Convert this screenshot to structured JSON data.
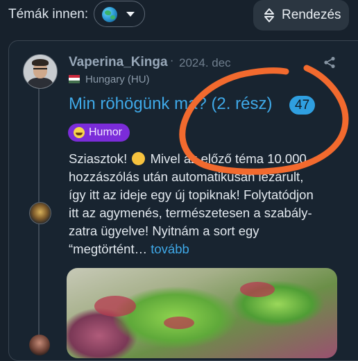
{
  "topbar": {
    "topics_label": "Témák innen:",
    "sort_label": "Rendezés",
    "globe_icon": "globe-icon",
    "sort_icon": "sliders-icon"
  },
  "post": {
    "username": "Vaperina_Kinga",
    "separator": "·",
    "date": "2024. dec",
    "country": "Hungary (HU)",
    "title": "Min röhögünk ma? (2. rész)",
    "reply_count": "47",
    "tag": "Humor",
    "excerpt_lines": [
      "Sziasztok! 🤗 Mivel az előző téma 10.000",
      "hozzászólás után automatikusan lezárult,",
      "így itt az ideje egy új topiknak! Folytatódjon",
      "itt az agymenés, természetesen a szabály-",
      "zatra ügyelve! Nyitnám a sort egy",
      "“megtörtént…"
    ],
    "excerpt_line1_a": "Sziasztok!",
    "excerpt_line1_b": "Mivel az előző téma 10.000",
    "excerpt_line2": "hozzászólás után automatikusan lezárult,",
    "excerpt_line3": "így itt az ideje egy új topiknak! Folytatódjon",
    "excerpt_line4": "itt az agymenés, természetesen a szabály-",
    "excerpt_line5": "zatra ügyelve! Nyitnám a sort egy",
    "excerpt_line6": "“megtörtént…",
    "more_link": "tovább"
  },
  "colors": {
    "background": "#17212c",
    "link": "#3fa9e8",
    "tag_bg": "#7b2cd9",
    "annotation": "#f26a2e"
  }
}
